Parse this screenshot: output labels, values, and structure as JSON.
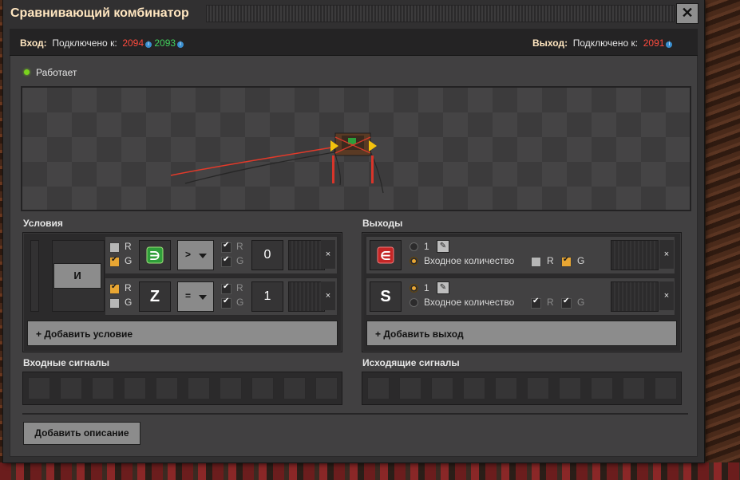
{
  "window": {
    "title": "Сравнивающий комбинатор",
    "close_label": "✕"
  },
  "status": {
    "input_label": "Вход:",
    "connected_label": "Подключено к:",
    "input_red": "2094",
    "input_green": "2093",
    "output_label": "Выход:",
    "output_connected_label": "Подключено к:",
    "output_red": "2091",
    "info_glyph": "i"
  },
  "state": {
    "text": "Работает"
  },
  "conditions": {
    "title": "Условия",
    "and_label": "И",
    "rows": [
      {
        "left_r": false,
        "left_g": true,
        "signal": "∋",
        "operator": ">",
        "right_r": true,
        "right_g": true,
        "constant": "0"
      },
      {
        "left_r": true,
        "left_g": false,
        "signal": "Z",
        "operator": "=",
        "right_r": true,
        "right_g": true,
        "constant": "1"
      }
    ],
    "r_label": "R",
    "g_label": "G",
    "remove_label": "×",
    "add_label": "+ Добавить условие"
  },
  "outputs": {
    "title": "Выходы",
    "rows": [
      {
        "signal": "∈",
        "value": "1",
        "mode": "Входное количество",
        "selected": "input_count",
        "r": false,
        "g": true
      },
      {
        "signal": "S",
        "value": "1",
        "mode": "Входное количество",
        "selected": "constant",
        "r": true,
        "g": true
      }
    ],
    "r_label": "R",
    "g_label": "G",
    "remove_label": "×",
    "add_label": "+ Добавить выход"
  },
  "input_signals": {
    "title": "Входные сигналы"
  },
  "output_signals": {
    "title": "Исходящие сигналы"
  },
  "description_button": "Добавить описание",
  "colors": {
    "accent": "#ffe6c0",
    "red_wire": "#ff4b3e",
    "green_wire": "#42d15d",
    "checkbox_on": "#e8a633"
  }
}
